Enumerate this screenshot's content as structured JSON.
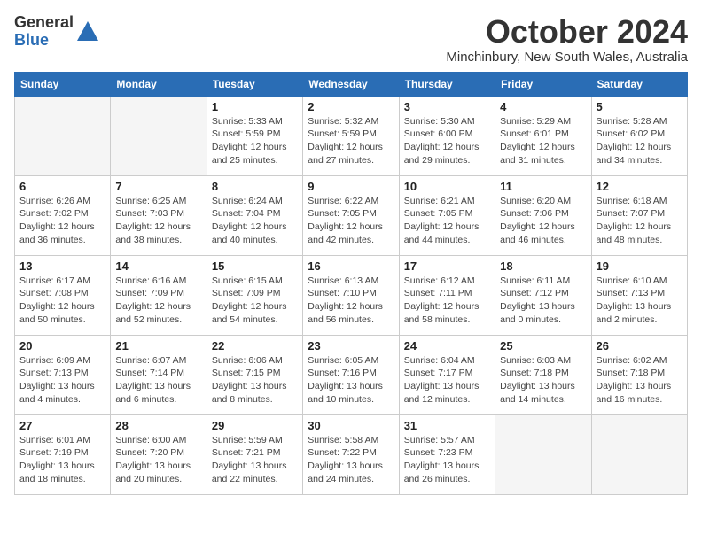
{
  "logo": {
    "general": "General",
    "blue": "Blue"
  },
  "title": "October 2024",
  "location": "Minchinbury, New South Wales, Australia",
  "days_header": [
    "Sunday",
    "Monday",
    "Tuesday",
    "Wednesday",
    "Thursday",
    "Friday",
    "Saturday"
  ],
  "weeks": [
    [
      {
        "num": "",
        "info": ""
      },
      {
        "num": "",
        "info": ""
      },
      {
        "num": "1",
        "info": "Sunrise: 5:33 AM\nSunset: 5:59 PM\nDaylight: 12 hours\nand 25 minutes."
      },
      {
        "num": "2",
        "info": "Sunrise: 5:32 AM\nSunset: 5:59 PM\nDaylight: 12 hours\nand 27 minutes."
      },
      {
        "num": "3",
        "info": "Sunrise: 5:30 AM\nSunset: 6:00 PM\nDaylight: 12 hours\nand 29 minutes."
      },
      {
        "num": "4",
        "info": "Sunrise: 5:29 AM\nSunset: 6:01 PM\nDaylight: 12 hours\nand 31 minutes."
      },
      {
        "num": "5",
        "info": "Sunrise: 5:28 AM\nSunset: 6:02 PM\nDaylight: 12 hours\nand 34 minutes."
      }
    ],
    [
      {
        "num": "6",
        "info": "Sunrise: 6:26 AM\nSunset: 7:02 PM\nDaylight: 12 hours\nand 36 minutes."
      },
      {
        "num": "7",
        "info": "Sunrise: 6:25 AM\nSunset: 7:03 PM\nDaylight: 12 hours\nand 38 minutes."
      },
      {
        "num": "8",
        "info": "Sunrise: 6:24 AM\nSunset: 7:04 PM\nDaylight: 12 hours\nand 40 minutes."
      },
      {
        "num": "9",
        "info": "Sunrise: 6:22 AM\nSunset: 7:05 PM\nDaylight: 12 hours\nand 42 minutes."
      },
      {
        "num": "10",
        "info": "Sunrise: 6:21 AM\nSunset: 7:05 PM\nDaylight: 12 hours\nand 44 minutes."
      },
      {
        "num": "11",
        "info": "Sunrise: 6:20 AM\nSunset: 7:06 PM\nDaylight: 12 hours\nand 46 minutes."
      },
      {
        "num": "12",
        "info": "Sunrise: 6:18 AM\nSunset: 7:07 PM\nDaylight: 12 hours\nand 48 minutes."
      }
    ],
    [
      {
        "num": "13",
        "info": "Sunrise: 6:17 AM\nSunset: 7:08 PM\nDaylight: 12 hours\nand 50 minutes."
      },
      {
        "num": "14",
        "info": "Sunrise: 6:16 AM\nSunset: 7:09 PM\nDaylight: 12 hours\nand 52 minutes."
      },
      {
        "num": "15",
        "info": "Sunrise: 6:15 AM\nSunset: 7:09 PM\nDaylight: 12 hours\nand 54 minutes."
      },
      {
        "num": "16",
        "info": "Sunrise: 6:13 AM\nSunset: 7:10 PM\nDaylight: 12 hours\nand 56 minutes."
      },
      {
        "num": "17",
        "info": "Sunrise: 6:12 AM\nSunset: 7:11 PM\nDaylight: 12 hours\nand 58 minutes."
      },
      {
        "num": "18",
        "info": "Sunrise: 6:11 AM\nSunset: 7:12 PM\nDaylight: 13 hours\nand 0 minutes."
      },
      {
        "num": "19",
        "info": "Sunrise: 6:10 AM\nSunset: 7:13 PM\nDaylight: 13 hours\nand 2 minutes."
      }
    ],
    [
      {
        "num": "20",
        "info": "Sunrise: 6:09 AM\nSunset: 7:13 PM\nDaylight: 13 hours\nand 4 minutes."
      },
      {
        "num": "21",
        "info": "Sunrise: 6:07 AM\nSunset: 7:14 PM\nDaylight: 13 hours\nand 6 minutes."
      },
      {
        "num": "22",
        "info": "Sunrise: 6:06 AM\nSunset: 7:15 PM\nDaylight: 13 hours\nand 8 minutes."
      },
      {
        "num": "23",
        "info": "Sunrise: 6:05 AM\nSunset: 7:16 PM\nDaylight: 13 hours\nand 10 minutes."
      },
      {
        "num": "24",
        "info": "Sunrise: 6:04 AM\nSunset: 7:17 PM\nDaylight: 13 hours\nand 12 minutes."
      },
      {
        "num": "25",
        "info": "Sunrise: 6:03 AM\nSunset: 7:18 PM\nDaylight: 13 hours\nand 14 minutes."
      },
      {
        "num": "26",
        "info": "Sunrise: 6:02 AM\nSunset: 7:18 PM\nDaylight: 13 hours\nand 16 minutes."
      }
    ],
    [
      {
        "num": "27",
        "info": "Sunrise: 6:01 AM\nSunset: 7:19 PM\nDaylight: 13 hours\nand 18 minutes."
      },
      {
        "num": "28",
        "info": "Sunrise: 6:00 AM\nSunset: 7:20 PM\nDaylight: 13 hours\nand 20 minutes."
      },
      {
        "num": "29",
        "info": "Sunrise: 5:59 AM\nSunset: 7:21 PM\nDaylight: 13 hours\nand 22 minutes."
      },
      {
        "num": "30",
        "info": "Sunrise: 5:58 AM\nSunset: 7:22 PM\nDaylight: 13 hours\nand 24 minutes."
      },
      {
        "num": "31",
        "info": "Sunrise: 5:57 AM\nSunset: 7:23 PM\nDaylight: 13 hours\nand 26 minutes."
      },
      {
        "num": "",
        "info": ""
      },
      {
        "num": "",
        "info": ""
      }
    ]
  ]
}
